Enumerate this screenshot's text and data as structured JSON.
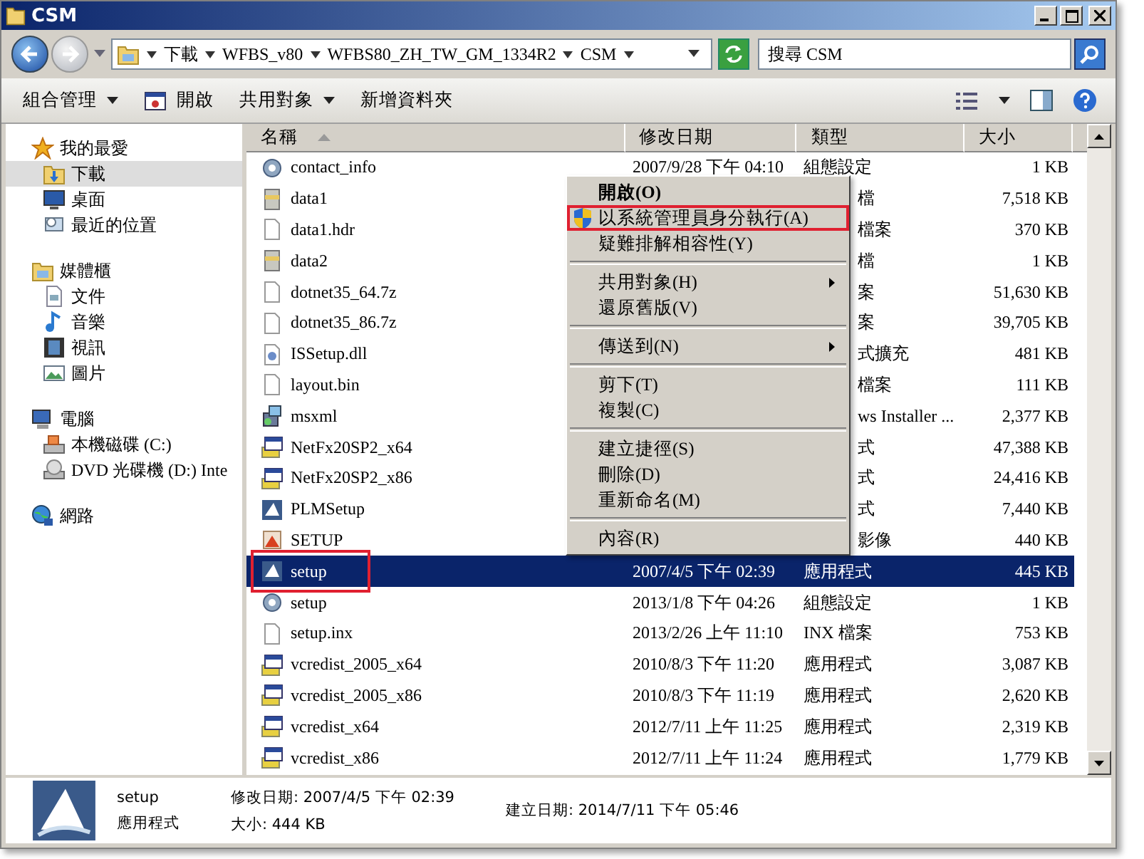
{
  "window": {
    "title": "CSM"
  },
  "address": {
    "crumbs": [
      "下載",
      "WFBS_v80",
      "WFBS80_ZH_TW_GM_1334R2",
      "CSM"
    ]
  },
  "search": {
    "placeholder": "搜尋 CSM"
  },
  "toolbar": [
    {
      "label": "組合管理",
      "dropdown": true,
      "icon": false
    },
    {
      "label": "開啟",
      "dropdown": false,
      "icon": true
    },
    {
      "label": "共用對象",
      "dropdown": true,
      "icon": false
    },
    {
      "label": "新增資料夾",
      "dropdown": false,
      "icon": false
    }
  ],
  "sidebar": {
    "groups": [
      {
        "label": "我的最愛",
        "children": [
          {
            "label": "下載",
            "selected": true
          },
          {
            "label": "桌面",
            "selected": false
          },
          {
            "label": "最近的位置",
            "selected": false
          }
        ]
      },
      {
        "label": "媒體櫃",
        "children": [
          {
            "label": "文件",
            "selected": false
          },
          {
            "label": "音樂",
            "selected": false
          },
          {
            "label": "視訊",
            "selected": false
          },
          {
            "label": "圖片",
            "selected": false
          }
        ]
      },
      {
        "label": "電腦",
        "children": [
          {
            "label": "本機磁碟 (C:)",
            "selected": false
          },
          {
            "label": "DVD 光碟機 (D:) Inte",
            "selected": false
          }
        ]
      },
      {
        "label": "網路"
      }
    ]
  },
  "table": {
    "columns": [
      {
        "label": "名稱",
        "sorted": true
      },
      {
        "label": "修改日期",
        "sorted": false
      },
      {
        "label": "類型",
        "sorted": false
      },
      {
        "label": "大小",
        "sorted": false
      }
    ],
    "rows": [
      {
        "name": "contact_info",
        "date": "2007/9/28 下午 04:10",
        "type": "組態設定",
        "size": "1 KB",
        "selected": false,
        "marked": false
      },
      {
        "name": "data1",
        "type": "檔",
        "size": "7,518 KB",
        "selected": false,
        "marked": false
      },
      {
        "name": "data1.hdr",
        "type": "檔案",
        "size": "370 KB",
        "selected": false,
        "marked": false
      },
      {
        "name": "data2",
        "type": "檔",
        "size": "1 KB",
        "selected": false,
        "marked": false
      },
      {
        "name": "dotnet35_64.7z",
        "type": "案",
        "size": "51,630 KB",
        "selected": false,
        "marked": false
      },
      {
        "name": "dotnet35_86.7z",
        "type": "案",
        "size": "39,705 KB",
        "selected": false,
        "marked": false
      },
      {
        "name": "ISSetup.dll",
        "type": "式擴充",
        "size": "481 KB",
        "selected": false,
        "marked": false
      },
      {
        "name": "layout.bin",
        "type": "檔案",
        "size": "111 KB",
        "selected": false,
        "marked": false
      },
      {
        "name": "msxml",
        "type": "ws Installer ...",
        "size": "2,377 KB",
        "selected": false,
        "marked": false
      },
      {
        "name": "NetFx20SP2_x64",
        "type": "式",
        "size": "47,388 KB",
        "selected": false,
        "marked": false
      },
      {
        "name": "NetFx20SP2_x86",
        "type": "式",
        "size": "24,416 KB",
        "selected": false,
        "marked": false
      },
      {
        "name": "PLMSetup",
        "type": "式",
        "size": "7,440 KB",
        "selected": false,
        "marked": false
      },
      {
        "name": "SETUP",
        "type": "影像",
        "size": "440 KB",
        "selected": false,
        "marked": false
      },
      {
        "name": "setup",
        "date": "2007/4/5 下午 02:39",
        "type": "應用程式",
        "size": "445 KB",
        "selected": true,
        "marked": true
      },
      {
        "name": "setup",
        "date": "2013/1/8 下午 04:26",
        "type": "組態設定",
        "size": "1 KB",
        "selected": false,
        "marked": false
      },
      {
        "name": "setup.inx",
        "date": "2013/2/26 上午 11:10",
        "type": "INX 檔案",
        "size": "753 KB",
        "selected": false,
        "marked": false
      },
      {
        "name": "vcredist_2005_x64",
        "date": "2010/8/3 下午 11:20",
        "type": "應用程式",
        "size": "3,087 KB",
        "selected": false,
        "marked": false
      },
      {
        "name": "vcredist_2005_x86",
        "date": "2010/8/3 下午 11:19",
        "type": "應用程式",
        "size": "2,620 KB",
        "selected": false,
        "marked": false
      },
      {
        "name": "vcredist_x64",
        "date": "2012/7/11 上午 11:25",
        "type": "應用程式",
        "size": "2,319 KB",
        "selected": false,
        "marked": false
      },
      {
        "name": "vcredist_x86",
        "date": "2012/7/11 上午 11:24",
        "type": "應用程式",
        "size": "1,779 KB",
        "selected": false,
        "marked": false
      }
    ]
  },
  "context_menu": [
    {
      "kind": "default",
      "label": "開啟(O)",
      "submenu": false,
      "marked": false
    },
    {
      "kind": "shield",
      "label": "以系統管理員身分執行(A)",
      "submenu": false,
      "marked": true
    },
    {
      "kind": "plain",
      "label": "疑難排解相容性(Y)",
      "submenu": false,
      "marked": false
    },
    {
      "kind": "separator"
    },
    {
      "kind": "plain",
      "label": "共用對象(H)",
      "submenu": true,
      "marked": false
    },
    {
      "kind": "plain",
      "label": "還原舊版(V)",
      "submenu": false,
      "marked": false
    },
    {
      "kind": "separator"
    },
    {
      "kind": "plain",
      "label": "傳送到(N)",
      "submenu": true,
      "marked": false
    },
    {
      "kind": "separator"
    },
    {
      "kind": "plain",
      "label": "剪下(T)",
      "submenu": false,
      "marked": false
    },
    {
      "kind": "plain",
      "label": "複製(C)",
      "submenu": false,
      "marked": false
    },
    {
      "kind": "separator"
    },
    {
      "kind": "plain",
      "label": "建立捷徑(S)",
      "submenu": false,
      "marked": false
    },
    {
      "kind": "plain",
      "label": "刪除(D)",
      "submenu": false,
      "marked": false
    },
    {
      "kind": "plain",
      "label": "重新命名(M)",
      "submenu": false,
      "marked": false
    },
    {
      "kind": "separator"
    },
    {
      "kind": "plain",
      "label": "內容(R)",
      "submenu": false,
      "marked": false
    }
  ],
  "details": {
    "name": "setup",
    "type": "應用程式",
    "modified": "修改日期: 2007/4/5 下午 02:39",
    "size": "大小: 444 KB",
    "created": "建立日期: 2014/7/11 下午 05:46"
  }
}
